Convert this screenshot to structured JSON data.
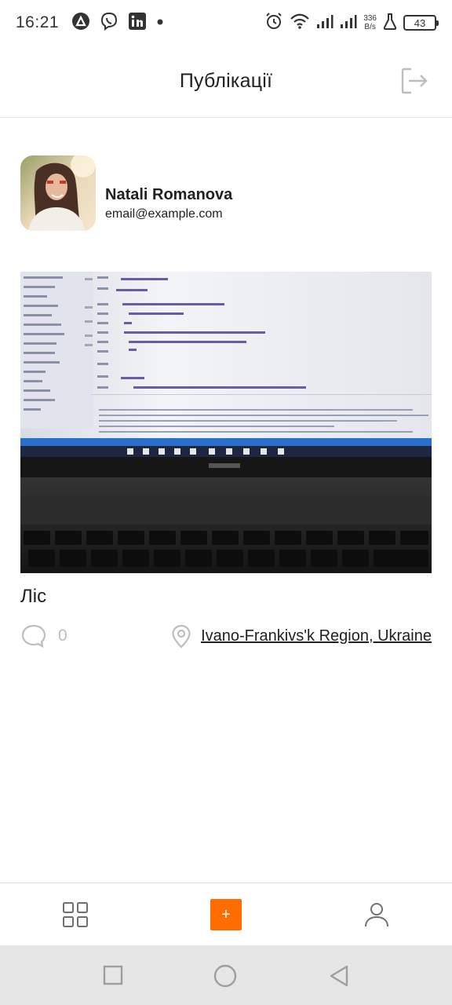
{
  "status_bar": {
    "time": "16:21",
    "net_speed_value": "336",
    "net_speed_unit": "B/s",
    "battery": "43"
  },
  "header": {
    "title": "Публікації"
  },
  "profile": {
    "name": "Natali Romanova",
    "email": "email@example.com"
  },
  "post": {
    "title": "Ліс",
    "comments_count": "0",
    "location": "Ivano-Frankivs'k Region, Ukraine"
  },
  "tab_bar": {
    "create_label": "+"
  },
  "colors": {
    "accent": "#ff6c00",
    "muted_icon": "#bdbdbd",
    "text": "#212121"
  },
  "icons": {
    "status_left": [
      "notification-app-icon",
      "viber-icon",
      "linkedin-icon",
      "dot-icon"
    ],
    "status_right": [
      "alarm-icon",
      "wifi-icon",
      "signal-icon",
      "signal-icon",
      "flask-icon",
      "battery-icon"
    ],
    "header": "logout-icon",
    "post": [
      "comment-icon",
      "location-pin-icon"
    ],
    "tabs": [
      "grid-icon",
      "plus-icon",
      "user-icon"
    ],
    "system_nav": [
      "recents-icon",
      "home-icon",
      "back-icon"
    ]
  }
}
